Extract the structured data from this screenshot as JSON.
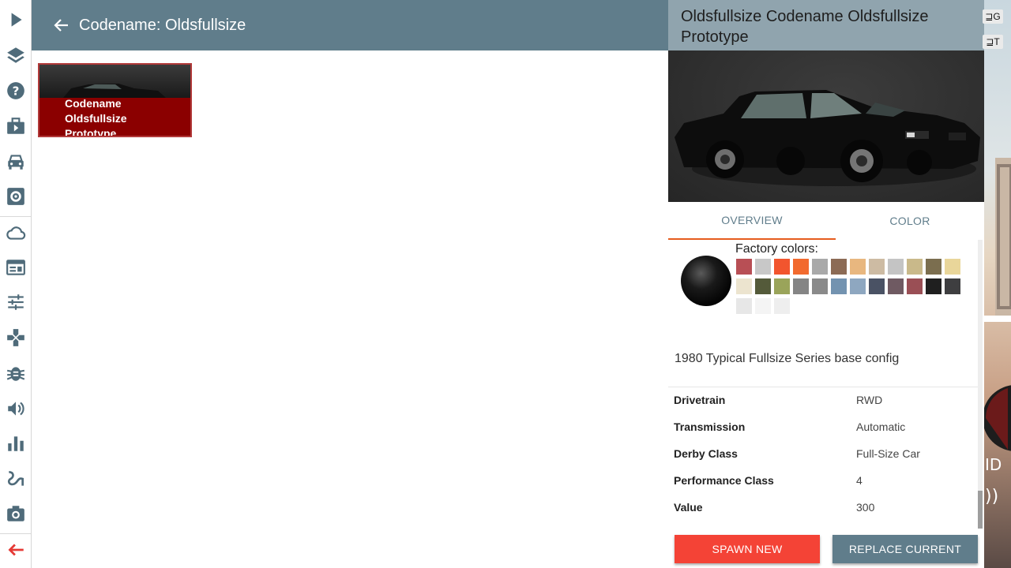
{
  "header": {
    "title": "Codename: Oldsfullsize"
  },
  "sidebar": {
    "items": [
      {
        "icon": "play-icon"
      },
      {
        "icon": "layers-icon"
      },
      {
        "icon": "help-icon"
      },
      {
        "icon": "briefcase-play-icon"
      },
      {
        "icon": "car-icon"
      },
      {
        "icon": "gear-icon"
      },
      {
        "icon": "cloud-icon"
      },
      {
        "icon": "window-icon"
      },
      {
        "icon": "tune-icon"
      },
      {
        "icon": "gamepad-icon"
      },
      {
        "icon": "bug-icon"
      },
      {
        "icon": "volume-icon"
      },
      {
        "icon": "bar-chart-icon"
      },
      {
        "icon": "route-icon"
      },
      {
        "icon": "camera-icon"
      },
      {
        "icon": "exit-arrow-icon"
      }
    ]
  },
  "tile": {
    "label": "Codename Oldsfullsize Prototype"
  },
  "detail": {
    "title": "Oldsfullsize Codename Oldsfullsize Prototype",
    "tabs": [
      "OVERVIEW",
      "COLOR"
    ],
    "factory_colors_label": "Factory colors:",
    "description": "1980 Typical Fullsize Series base config",
    "specs": [
      {
        "key": "Drivetrain",
        "value": "RWD"
      },
      {
        "key": "Transmission",
        "value": "Automatic"
      },
      {
        "key": "Derby Class",
        "value": "Full-Size Car"
      },
      {
        "key": "Performance Class",
        "value": "4"
      },
      {
        "key": "Value",
        "value": "300"
      }
    ],
    "spawn_label": "SPAWN NEW",
    "replace_label": "REPLACE CURRENT"
  },
  "hud": {
    "g": "⊒G",
    "t": "⊒T"
  },
  "colors": {
    "accent": "#607d8b",
    "header_bg": "#90a4ae",
    "spawn": "#f44336",
    "tab_underline": "#e65c1e",
    "tile_bg": "#8b0000",
    "swatches": [
      "#b84f55",
      "#c8c8c8",
      "#f2552e",
      "#f26a2e",
      "#a9a9a9",
      "#8c6b55",
      "#e8b77f",
      "#cdbba3",
      "#c4c4c4",
      "#c9b98a",
      "#7b6e4f",
      "#e9d69a",
      "#ece4cf",
      "#545a3a",
      "#9aa45a",
      "#858585",
      "#8a8a8a",
      "#7393b0",
      "#8ea7c0",
      "#4a5264",
      "#6f5a62",
      "#9a4f55",
      "#1f1f1f",
      "#3e3e40",
      "#e7e7e7",
      "#f4f4f4",
      "#eeeeee"
    ]
  }
}
